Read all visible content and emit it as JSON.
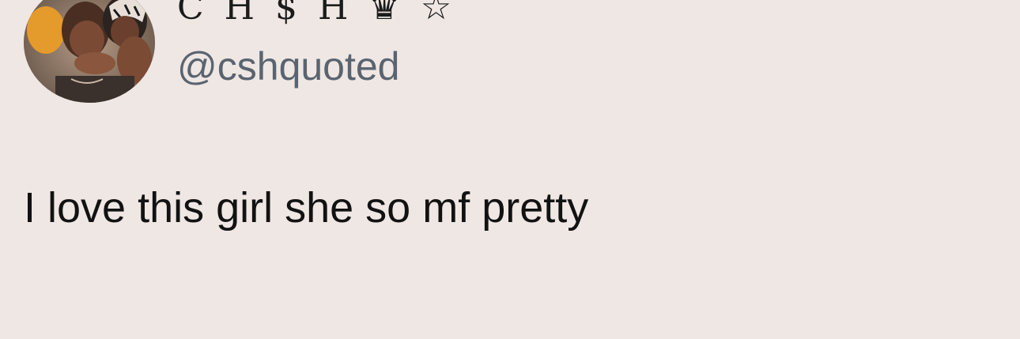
{
  "user": {
    "display_name": "C H $ H ♛ ☆",
    "handle": "@cshquoted",
    "avatar_icon": "profile-photo"
  },
  "tweet": {
    "text": "I love this girl she so mf pretty"
  }
}
